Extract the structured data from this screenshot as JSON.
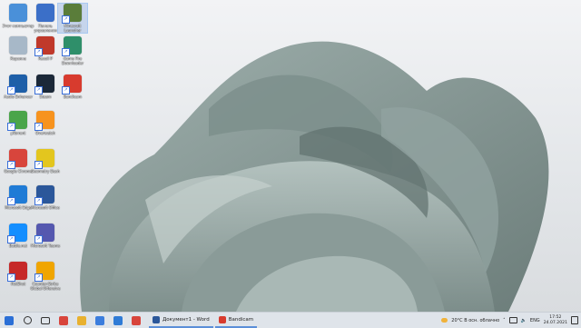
{
  "desktop": {
    "icons": [
      {
        "label": "Этот компьютер",
        "color": "#4a90d9"
      },
      {
        "label": "Панель управления",
        "color": "#3b6fc8"
      },
      {
        "label": "Minecraft Launcher",
        "color": "#5a7d3a"
      },
      {
        "label": "Корзина",
        "color": "#a7b8c8"
      },
      {
        "label": "Recoil P",
        "color": "#c0392b"
      },
      {
        "label": "Game Fire Downloader",
        "color": "#2f8f6a"
      },
      {
        "label": "Audio Enhancer",
        "color": "#1e5fa8"
      },
      {
        "label": "Steam",
        "color": "#1b2838"
      },
      {
        "label": "Bandicam",
        "color": "#d83b2e"
      },
      {
        "label": "µTorrent",
        "color": "#4aa54a"
      },
      {
        "label": "Overwatch",
        "color": "#f7931e"
      },
      {
        "label": "Google Chrome",
        "color": "#d8453c"
      },
      {
        "label": "Geometry Dash",
        "color": "#e3c61e"
      },
      {
        "label": "Microsoft Edge",
        "color": "#1f7bd6"
      },
      {
        "label": "Microsoft Office",
        "color": "#2b579a"
      },
      {
        "label": "Battle.net",
        "color": "#148eff"
      },
      {
        "label": "Microsoft Teams",
        "color": "#5558af"
      },
      {
        "label": "HotShot",
        "color": "#c62828"
      },
      {
        "label": "Counter-Strike Global Offensive",
        "color": "#f0a500"
      }
    ]
  },
  "taskbar": {
    "pinned": [
      {
        "name": "start",
        "color": "#2b6fd6"
      },
      {
        "name": "search",
        "color": "#333"
      },
      {
        "name": "task-view",
        "color": "#333"
      },
      {
        "name": "chrome",
        "color": "#d8453c"
      },
      {
        "name": "explorer",
        "color": "#e8b130"
      },
      {
        "name": "store",
        "color": "#3b7ddd"
      },
      {
        "name": "mail",
        "color": "#2f7bd6"
      },
      {
        "name": "chrome-2",
        "color": "#d8453c"
      }
    ],
    "windows": [
      {
        "title": "Документ1 - Word",
        "color": "#2b579a"
      },
      {
        "title": "Bandicam",
        "color": "#d83b2e"
      }
    ],
    "tray": {
      "weather": "20°C  В осн. облачно",
      "lang": "ENG",
      "time": "17:52",
      "date": "24.07.2021"
    }
  }
}
